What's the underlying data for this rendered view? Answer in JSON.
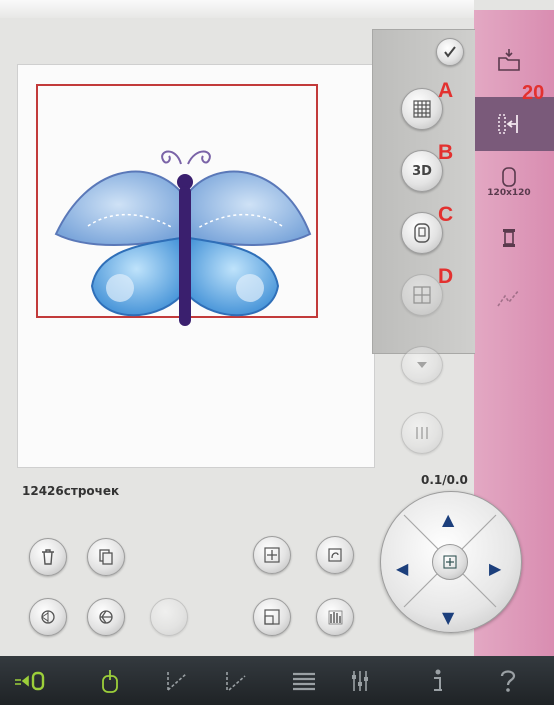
{
  "embroidery": {
    "stitch_count_label": "12426строчек",
    "zoom_value": "0.1/0.0",
    "hoop_label": "120x120"
  },
  "callouts": {
    "a": "A",
    "b": "B",
    "c": "C",
    "d": "D",
    "number": "20"
  },
  "panel": {
    "btn_3d_label": "3D"
  },
  "icons": {
    "grid": "grid-icon",
    "three_d": "3d-icon",
    "hoop_outline": "hoop-outline-icon",
    "confirm": "checkmark-icon",
    "delete": "trash-icon",
    "copy": "copy-icon",
    "move": "move-icon",
    "rotate": "rotate-icon"
  },
  "colors": {
    "accent_pink": "#d98db1",
    "callout_red": "#e3312f",
    "hoop_red": "#c23a3a",
    "arrow_blue": "#1c3f7c",
    "bottom_bar_green": "#9ccf3a"
  }
}
